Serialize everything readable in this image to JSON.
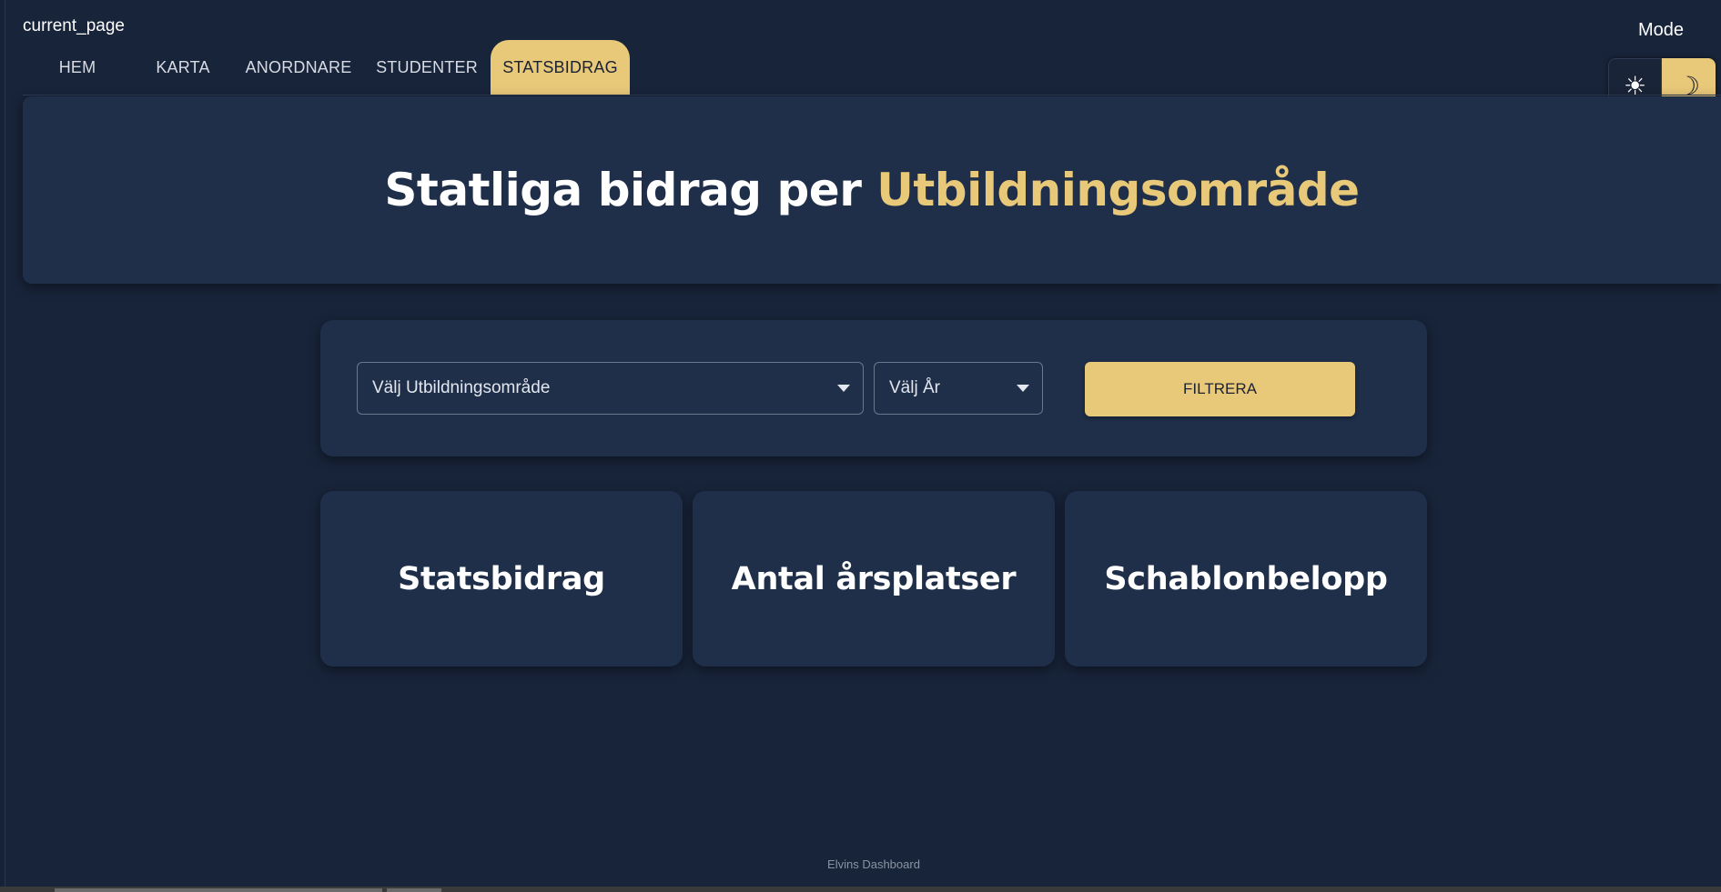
{
  "page": {
    "current_page_label": "current_page",
    "mode_label": "Mode"
  },
  "mode_toggle": {
    "light_icon": "sun-icon",
    "dark_icon": "moon-icon",
    "light_glyph": "☀",
    "dark_glyph": "☽",
    "selected": "dark"
  },
  "tabs": [
    {
      "label": "HEM",
      "active": false
    },
    {
      "label": "KARTA",
      "active": false
    },
    {
      "label": "ANORDNARE",
      "active": false
    },
    {
      "label": "STUDENTER",
      "active": false
    },
    {
      "label": "STATSBIDRAG",
      "active": true
    }
  ],
  "hero": {
    "title_prefix": "Statliga bidrag per ",
    "title_accent": "Utbildningsområde"
  },
  "filters": {
    "area_placeholder": "Välj Utbildningsområde",
    "year_placeholder": "Välj År",
    "button_label": "FILTRERA"
  },
  "cards": [
    {
      "title": "Statsbidrag"
    },
    {
      "title": "Antal årsplatser"
    },
    {
      "title": "Schablonbelopp"
    }
  ],
  "footer": {
    "text": "Elvins Dashboard"
  },
  "colors": {
    "accent": "#e8c879",
    "background": "#18243a",
    "panel": "#1f2f49"
  }
}
